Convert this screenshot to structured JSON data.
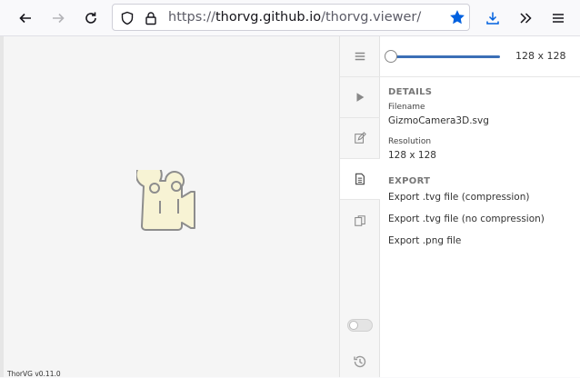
{
  "browser": {
    "url_prefix": "https://",
    "url_domain": "thorvg.github.io",
    "url_path": "/thorvg.viewer/",
    "icons": {
      "back": "arrow-left-icon",
      "forward": "arrow-right-icon",
      "reload": "reload-icon",
      "shield": "shield-icon",
      "lock": "lock-icon",
      "bookmark": "star-icon",
      "downloads": "download-icon",
      "overflow": "chevron-double-right-icon",
      "menu": "hamburger-menu-icon"
    },
    "accent": "#0060df"
  },
  "viewer": {
    "version": "ThorVG v0.11.0",
    "sidebar": [
      {
        "name": "menu-icon"
      },
      {
        "name": "play-icon"
      },
      {
        "name": "edit-icon"
      },
      {
        "name": "document-icon"
      },
      {
        "name": "copy-icon"
      }
    ],
    "slider": {
      "value_label": "128 x 128",
      "fraction": 0.0
    },
    "details": {
      "heading": "DETAILS",
      "filename_label": "Filename",
      "filename": "GizmoCamera3D.svg",
      "resolution_label": "Resolution",
      "resolution": "128 x 128"
    },
    "export": {
      "heading": "EXPORT",
      "items": [
        "Export .tvg file (compression)",
        "Export .tvg file (no compression)",
        "Export .png file"
      ]
    },
    "toggle_on": false
  }
}
